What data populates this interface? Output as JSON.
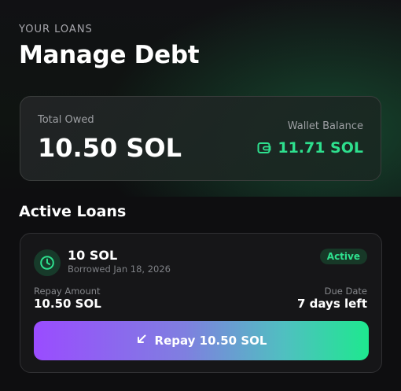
{
  "header": {
    "eyebrow": "YOUR LOANS",
    "title": "Manage Debt"
  },
  "summary": {
    "total_label": "Total Owed",
    "total_value": "10.50 SOL",
    "wallet_label": "Wallet Balance",
    "wallet_value": "11.71 SOL",
    "wallet_icon": "wallet-icon"
  },
  "active_loans": {
    "title": "Active Loans",
    "loans": [
      {
        "amount": "10 SOL",
        "borrowed": "Borrowed Jan 18, 2026",
        "status": "Active",
        "icon": "clock-icon",
        "repay_label": "Repay Amount",
        "repay_value": "10.50 SOL",
        "due_label": "Due Date",
        "due_value": "7 days left",
        "button_label": "Repay 10.50 SOL",
        "button_icon": "arrow-down-left-icon"
      }
    ]
  },
  "colors": {
    "background": "#0e0e10",
    "accent_green": "#2ee08e",
    "button_gradient_start": "#9a4cff",
    "button_gradient_end": "#1ee88f",
    "card_border": "#303033"
  }
}
